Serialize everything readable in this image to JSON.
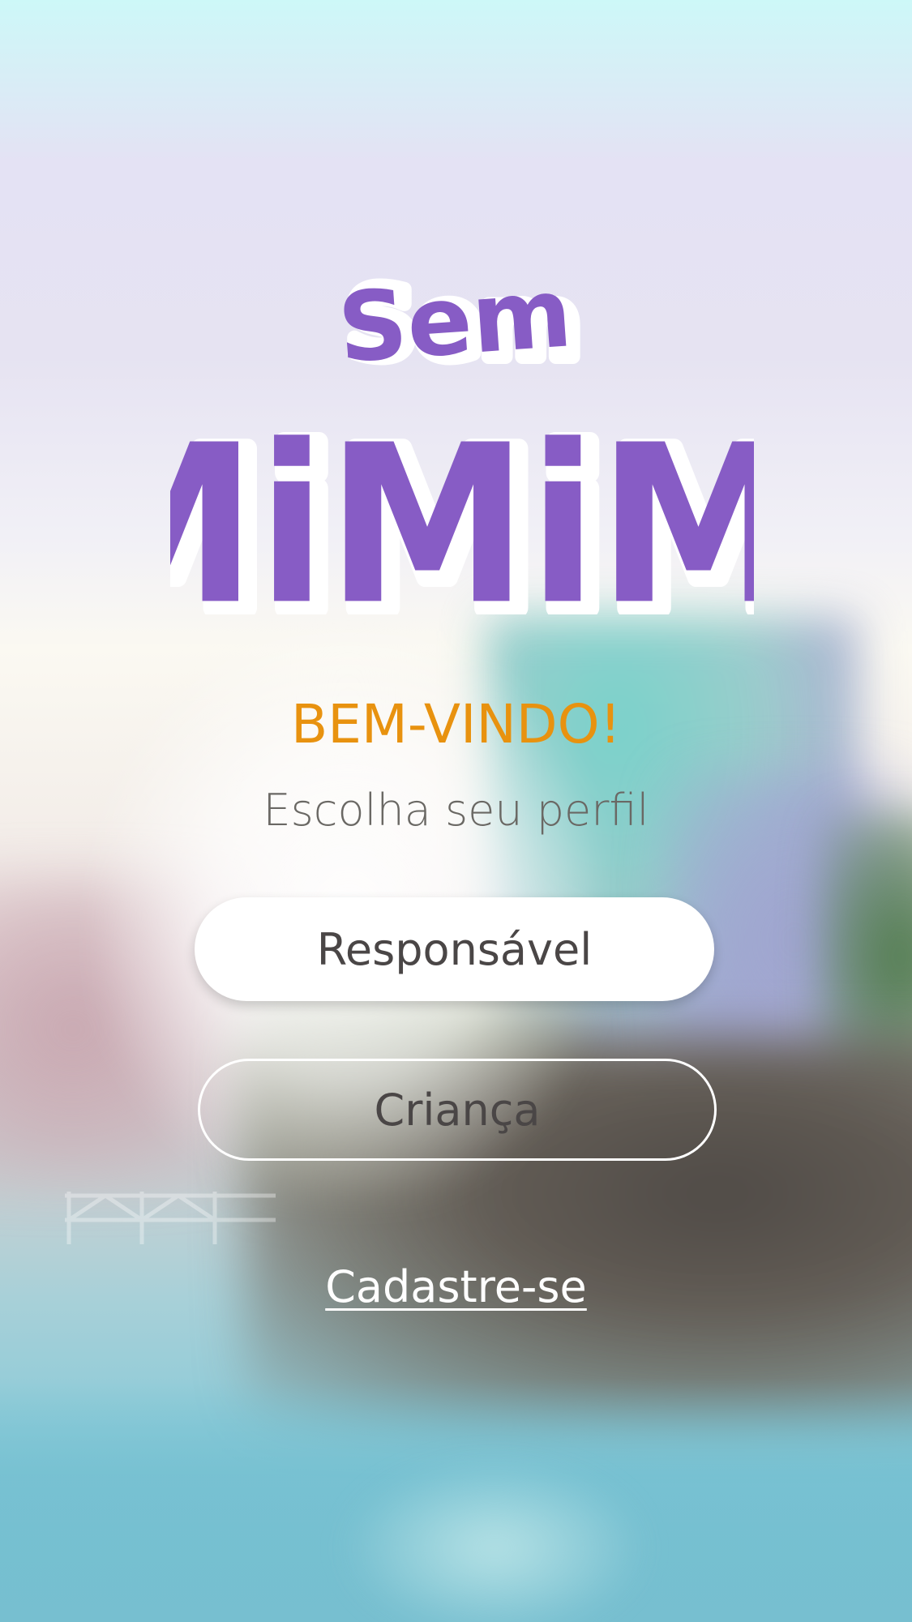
{
  "app": {
    "logo_line1": "Sem",
    "logo_line2": "MiMiMi"
  },
  "welcome": {
    "title": "BEM-VINDO!",
    "subtitle": "Escolha seu perfil"
  },
  "profiles": {
    "responsavel_label": "Responsável",
    "crianca_label": "Criança"
  },
  "signup": {
    "link_label": "Cadastre-se"
  },
  "colors": {
    "brand_purple": "#875cc5",
    "accent_orange": "#e8920f",
    "text_gray": "#4a4646"
  }
}
